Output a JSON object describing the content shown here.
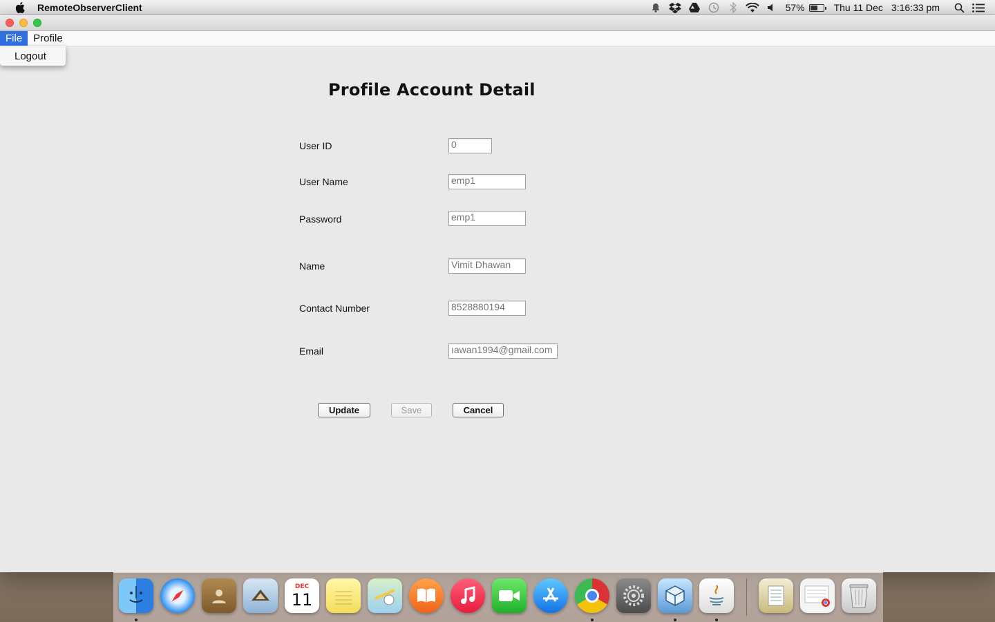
{
  "menubar": {
    "app_name": "RemoteObserverClient",
    "battery": "57%",
    "battery_level": 0.57,
    "date": "Thu 11 Dec",
    "time": "3:16:33 pm"
  },
  "app_menu": {
    "items": [
      "File",
      "Profile"
    ],
    "active": "File",
    "dropdown": [
      "Logout"
    ]
  },
  "form": {
    "title": "Profile Account Detail",
    "fields": [
      {
        "label": "User ID",
        "value": "0"
      },
      {
        "label": "User Name",
        "value": "emp1"
      },
      {
        "label": "Password",
        "value": "emp1"
      },
      {
        "label": "Name",
        "value": "Vimit Dhawan"
      },
      {
        "label": "Contact Number",
        "value": "8528880194"
      },
      {
        "label": "Email",
        "value": "ıawan1994@gmail.com"
      }
    ],
    "buttons": {
      "update": "Update",
      "save": "Save",
      "cancel": "Cancel"
    }
  },
  "dock": {
    "calendar_month": "DEC",
    "calendar_day": "11",
    "apps": [
      "finder-icon",
      "safari-icon",
      "contacts-icon",
      "mail-icon",
      "calendar-icon",
      "notes-icon",
      "maps-icon",
      "ibooks-icon",
      "itunes-icon",
      "facetime-icon",
      "app-store-icon",
      "chrome-icon",
      "system-preferences-icon",
      "virtualbox-icon",
      "java-icon",
      "documents-stack-icon",
      "chrome-file-icon",
      "trash-icon"
    ]
  },
  "colors": {
    "menu_highlight": "#2f6fe0",
    "window_bg": "#e9e9e9"
  }
}
